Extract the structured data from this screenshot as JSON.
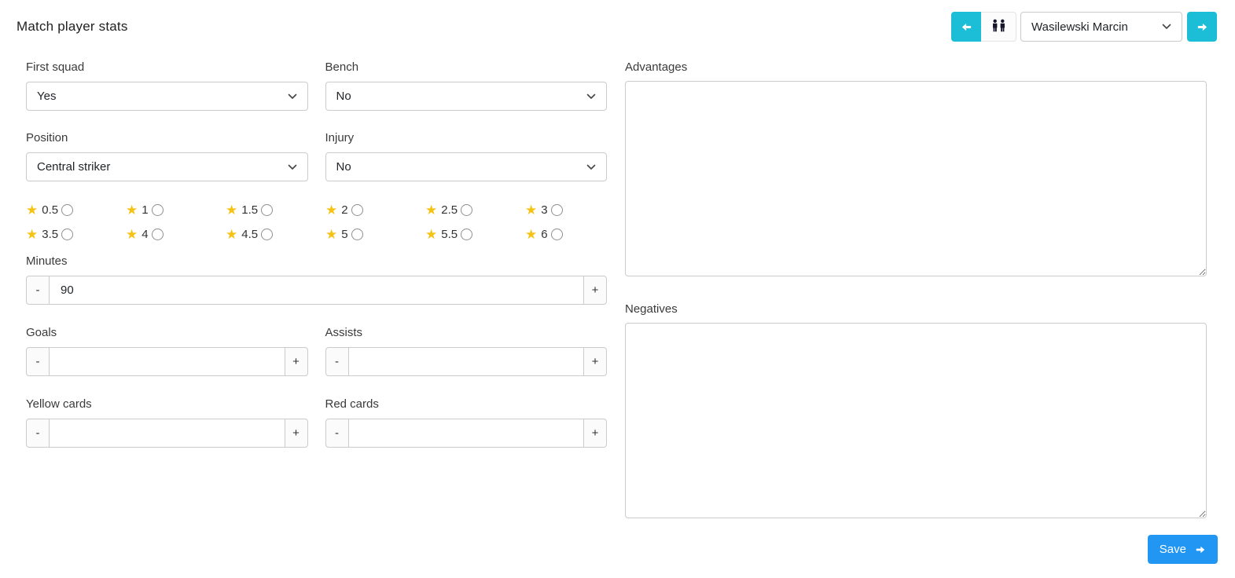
{
  "title": "Match player stats",
  "nav": {
    "player": "Wasilewski Marcin"
  },
  "form": {
    "first_squad": {
      "label": "First squad",
      "value": "Yes"
    },
    "bench": {
      "label": "Bench",
      "value": "No"
    },
    "position": {
      "label": "Position",
      "value": "Central striker"
    },
    "injury": {
      "label": "Injury",
      "value": "No"
    },
    "minutes": {
      "label": "Minutes",
      "value": "90"
    },
    "goals": {
      "label": "Goals",
      "value": ""
    },
    "assists": {
      "label": "Assists",
      "value": ""
    },
    "yellow_cards": {
      "label": "Yellow cards",
      "value": ""
    },
    "red_cards": {
      "label": "Red cards",
      "value": ""
    },
    "advantages": {
      "label": "Advantages",
      "value": ""
    },
    "negatives": {
      "label": "Negatives",
      "value": ""
    }
  },
  "stepper": {
    "minus": "-",
    "plus": "+"
  },
  "rating": {
    "star_glyph": "★",
    "options": [
      "0.5",
      "1",
      "1.5",
      "2",
      "2.5",
      "3",
      "3.5",
      "4",
      "4.5",
      "5",
      "5.5",
      "6"
    ],
    "selected": null
  },
  "actions": {
    "save": "Save"
  },
  "icons": {
    "prev": "arrow-left-icon",
    "next": "arrow-right-icon",
    "players": "people-icon",
    "dropdown": "chevron-down-icon",
    "save_arrow": "arrow-right-icon"
  },
  "colors": {
    "accent_cyan": "#1bbed6",
    "save_blue": "#2196f3",
    "star_yellow": "#f6c213"
  }
}
